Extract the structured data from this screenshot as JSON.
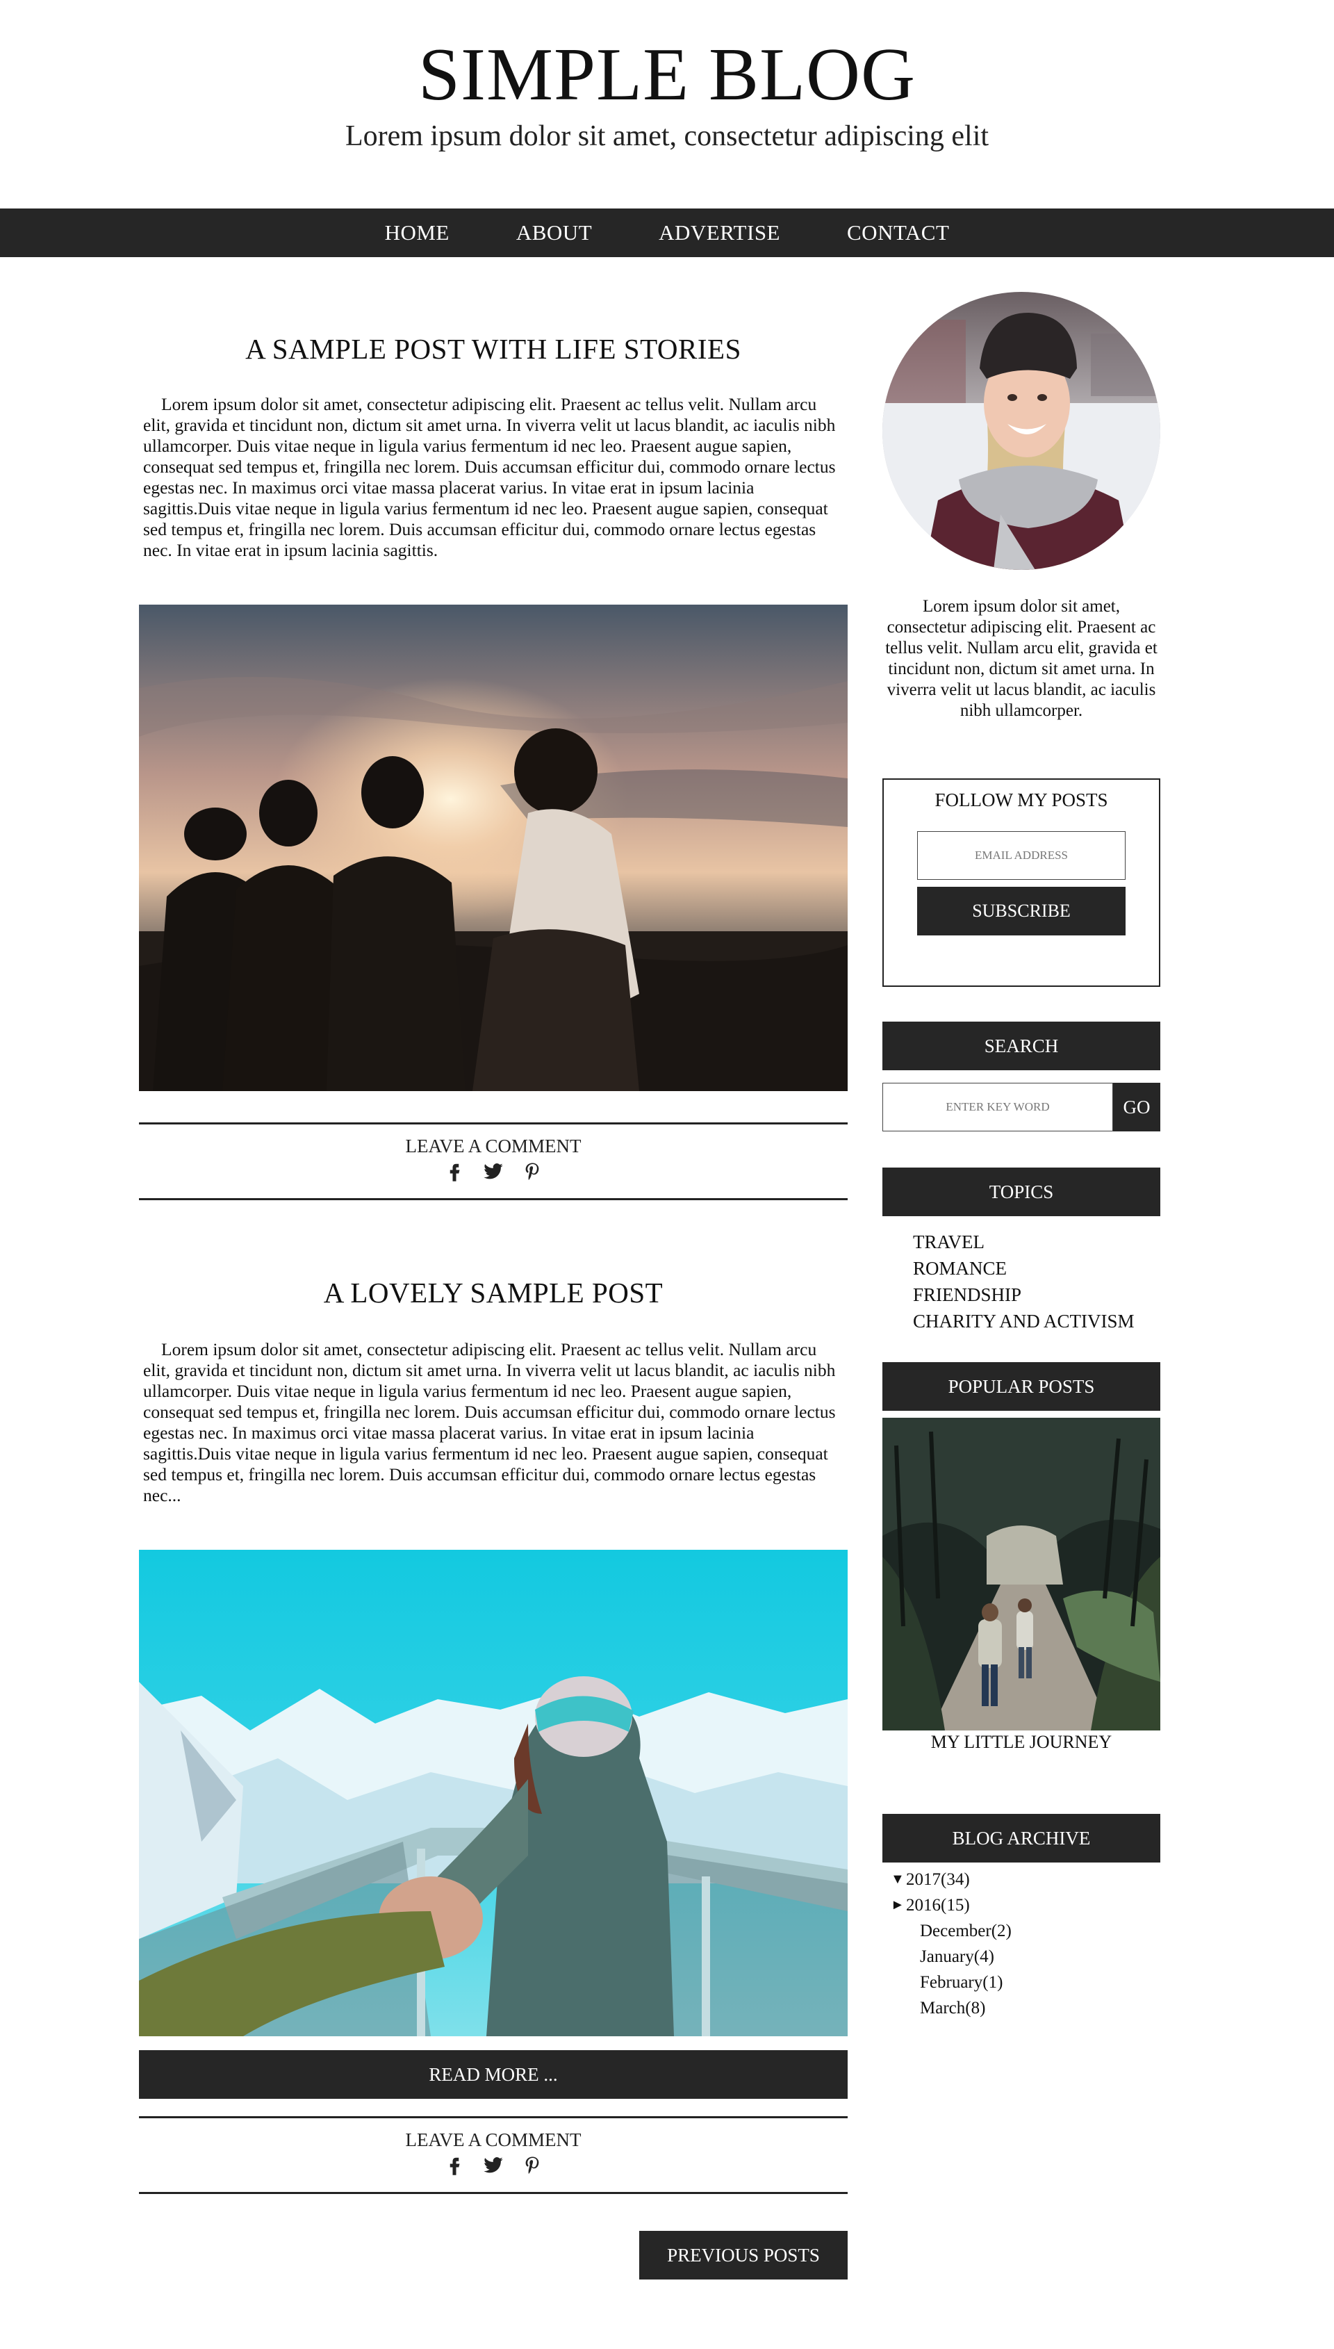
{
  "header": {
    "title": "SIMPLE BLOG",
    "tagline": "Lorem ipsum dolor sit amet, consectetur adipiscing elit"
  },
  "nav": {
    "items": [
      "HOME",
      "ABOUT",
      "ADVERTISE",
      "CONTACT"
    ]
  },
  "posts": [
    {
      "title": "A SAMPLE POST WITH LIFE STORIES",
      "body": "Lorem ipsum dolor sit amet, consectetur adipiscing elit. Praesent ac tellus velit. Nullam arcu elit, gravida et tincidunt non, dictum sit amet urna. In viverra velit ut lacus blandit, ac iaculis nibh ullamcorper. Duis vitae neque in ligula varius fermentum id nec leo. Praesent augue sapien, consequat sed tempus et, fringilla nec lorem. Duis accumsan efficitur dui, commodo ornare lectus egestas nec. In maximus orci vitae massa placerat varius. In vitae erat in ipsum lacinia sagittis.Duis vitae neque in ligula varius fermentum id nec leo. Praesent augue sapien, consequat sed tempus et, fringilla nec lorem. Duis accumsan efficitur dui, commodo ornare lectus egestas nec. In vitae erat in ipsum lacinia sagittis.",
      "image_icon": "friends-sunset-photo",
      "comment_label": "LEAVE A COMMENT"
    },
    {
      "title": "A LOVELY SAMPLE POST",
      "body": "Lorem ipsum dolor sit amet, consectetur adipiscing elit. Praesent ac tellus velit. Nullam arcu elit, gravida et tincidunt non, dictum sit amet urna. In viverra velit ut lacus blandit, ac iaculis nibh ullamcorper. Duis vitae neque in ligula varius fermentum id nec leo. Praesent augue sapien, consequat sed tempus et, fringilla nec lorem. Duis accumsan efficitur dui, commodo ornare lectus egestas nec. In maximus orci vitae massa placerat varius. In vitae erat in ipsum lacinia sagittis.Duis vitae neque in ligula varius fermentum id nec leo. Praesent augue sapien, consequat sed tempus et, fringilla nec lorem. Duis accumsan efficitur dui, commodo ornare lectus egestas nec...",
      "image_icon": "mountain-follow-me-photo",
      "read_more_label": "READ MORE ...",
      "comment_label": "LEAVE A COMMENT"
    }
  ],
  "pagination": {
    "previous_label": "PREVIOUS POSTS"
  },
  "sidebar": {
    "about_text": "Lorem ipsum dolor sit amet, consectetur adipiscing elit. Praesent ac tellus velit. Nullam arcu elit, gravida et tincidunt non, dictum sit amet urna. In viverra velit ut lacus blandit, ac iaculis nibh ullamcorper.",
    "follow": {
      "title": "FOLLOW MY POSTS",
      "email_placeholder": "EMAIL ADDRESS",
      "subscribe_label": "SUBSCRIBE"
    },
    "search": {
      "header": "SEARCH",
      "placeholder": "ENTER KEY WORD",
      "go_label": "GO"
    },
    "topics": {
      "header": "TOPICS",
      "items": [
        "TRAVEL",
        "ROMANCE",
        "FRIENDSHIP",
        "CHARITY AND ACTIVISM"
      ]
    },
    "popular": {
      "header": "POPULAR POSTS",
      "caption": "MY LITTLE JOURNEY"
    },
    "archive": {
      "header": "BLOG ARCHIVE",
      "years": [
        {
          "arrow": "▼",
          "label": "2017",
          "count": "(34)"
        },
        {
          "arrow": "►",
          "label": "2016",
          "count": "(15)"
        }
      ],
      "months": [
        {
          "label": "December",
          "count": "(2)"
        },
        {
          "label": "January",
          "count": "(4)"
        },
        {
          "label": "February",
          "count": "(1)"
        },
        {
          "label": "March",
          "count": "(8)"
        }
      ]
    }
  },
  "icons": [
    "facebook-icon",
    "twitter-icon",
    "pinterest-icon"
  ],
  "colors": {
    "dark": "#262626",
    "text": "#111111",
    "background": "#ffffff"
  }
}
